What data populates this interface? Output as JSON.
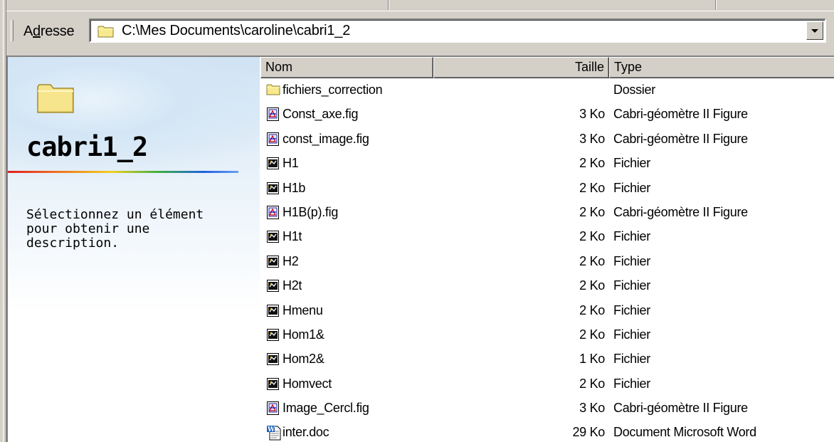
{
  "address_bar": {
    "label": "Adresse",
    "path": "C:\\Mes Documents\\caroline\\cabri1_2"
  },
  "webview": {
    "folder_name": "cabri1_2",
    "description": "Sélectionnez un élément pour obtenir une description."
  },
  "columns": {
    "name": "Nom",
    "size": "Taille",
    "type": "Type"
  },
  "files": [
    {
      "name": "fichiers_correction",
      "size": "",
      "type": "Dossier",
      "icon": "folder-icon"
    },
    {
      "name": "Const_axe.fig",
      "size": "3 Ko",
      "type": "Cabri-géomètre II Figure",
      "icon": "cabri-figure-icon"
    },
    {
      "name": "const_image.fig",
      "size": "3 Ko",
      "type": "Cabri-géomètre II Figure",
      "icon": "cabri-figure-icon"
    },
    {
      "name": "H1",
      "size": "2 Ko",
      "type": "Fichier",
      "icon": "generic-file-icon"
    },
    {
      "name": "H1b",
      "size": "2 Ko",
      "type": "Fichier",
      "icon": "generic-file-icon"
    },
    {
      "name": "H1B(p).fig",
      "size": "2 Ko",
      "type": "Cabri-géomètre II Figure",
      "icon": "cabri-figure-icon"
    },
    {
      "name": "H1t",
      "size": "2 Ko",
      "type": "Fichier",
      "icon": "generic-file-icon"
    },
    {
      "name": "H2",
      "size": "2 Ko",
      "type": "Fichier",
      "icon": "generic-file-icon"
    },
    {
      "name": "H2t",
      "size": "2 Ko",
      "type": "Fichier",
      "icon": "generic-file-icon"
    },
    {
      "name": "Hmenu",
      "size": "2 Ko",
      "type": "Fichier",
      "icon": "generic-file-icon"
    },
    {
      "name": "Hom1&",
      "size": "2 Ko",
      "type": "Fichier",
      "icon": "generic-file-icon"
    },
    {
      "name": "Hom2&",
      "size": "1 Ko",
      "type": "Fichier",
      "icon": "generic-file-icon"
    },
    {
      "name": "Homvect",
      "size": "2 Ko",
      "type": "Fichier",
      "icon": "generic-file-icon"
    },
    {
      "name": "Image_Cercl.fig",
      "size": "3 Ko",
      "type": "Cabri-géomètre II Figure",
      "icon": "cabri-figure-icon"
    },
    {
      "name": "inter.doc",
      "size": "29 Ko",
      "type": "Document Microsoft Word",
      "icon": "word-document-icon"
    }
  ]
}
